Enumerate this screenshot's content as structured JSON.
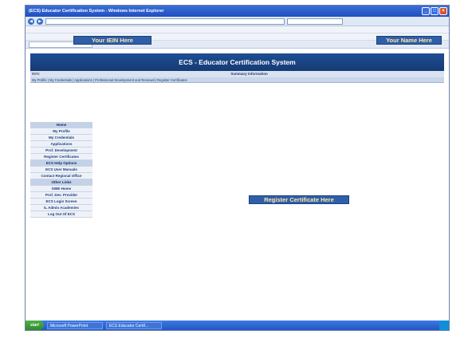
{
  "window": {
    "title": "(ECS) Educator Certification System - Windows Internet Explorer"
  },
  "banner": {
    "title": "ECS - Educator Certification System"
  },
  "subbar": {
    "iein_label": "IEIN:",
    "summary": "Summary Information"
  },
  "navrow": {
    "text": "My Profile | My Credentials | Applications | Professional Development and Renewal | Register Certificates"
  },
  "overlays": {
    "iein": "Your IEIN Here",
    "name": "Your Name Here",
    "register": "Register Certificate Here"
  },
  "sidebar": {
    "items": [
      "Home",
      "My Profile",
      "My Credentials",
      "Applications",
      "Prof. Development",
      "Register Certificates",
      "ECS Help Options",
      "ECS User Manuals",
      "Contact Regional Office",
      "Other Links",
      "ISBE Home",
      "Prof. Dev. Provider",
      "ECS Login Screen",
      "IL Admin Academies",
      "Log Out Of ECS"
    ]
  },
  "taskbar": {
    "start": "start",
    "item1": "Microsoft PowerPoint",
    "item2": "ECS Educator Certif..."
  }
}
